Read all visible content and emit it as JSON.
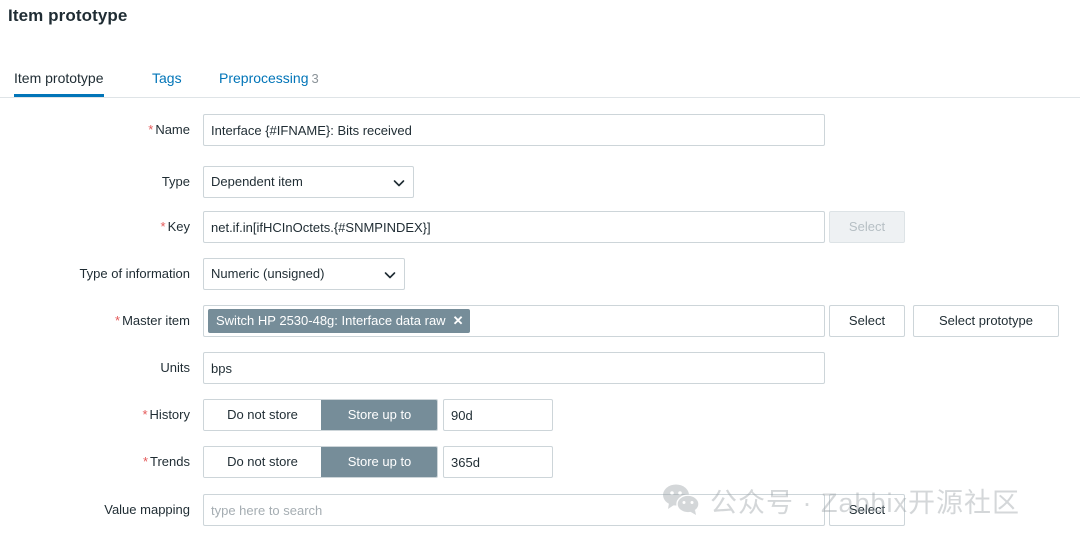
{
  "page": {
    "title": "Item prototype"
  },
  "tabs": [
    {
      "label": "Item prototype",
      "active": true
    },
    {
      "label": "Tags",
      "active": false
    },
    {
      "label": "Preprocessing",
      "count": "3",
      "active": false
    }
  ],
  "form": {
    "name": {
      "label": "Name",
      "required": true,
      "value": "Interface {#IFNAME}: Bits received"
    },
    "type": {
      "label": "Type",
      "required": false,
      "value": "Dependent item"
    },
    "key": {
      "label": "Key",
      "required": true,
      "value": "net.if.in[ifHCInOctets.{#SNMPINDEX}]",
      "button": "Select",
      "button_disabled": true
    },
    "type_of_information": {
      "label": "Type of information",
      "required": false,
      "value": "Numeric (unsigned)"
    },
    "master_item": {
      "label": "Master item",
      "required": true,
      "chip": "Switch HP 2530-48g: Interface data raw",
      "chip_remove": "✕",
      "button_select": "Select",
      "button_select_prototype": "Select prototype"
    },
    "units": {
      "label": "Units",
      "required": false,
      "value": "bps"
    },
    "history": {
      "label": "History",
      "required": true,
      "options": [
        "Do not store",
        "Store up to"
      ],
      "selected": "Store up to",
      "value": "90d"
    },
    "trends": {
      "label": "Trends",
      "required": true,
      "options": [
        "Do not store",
        "Store up to"
      ],
      "selected": "Store up to",
      "value": "365d"
    },
    "value_mapping": {
      "label": "Value mapping",
      "required": false,
      "placeholder": "type here to search",
      "value": "",
      "button": "Select"
    }
  },
  "watermark": {
    "text": "公众号 · Zabbix开源社区"
  },
  "colors": {
    "accent": "#0275b8",
    "required": "#e45959",
    "chip": "#768d99",
    "border": "#cdd5d9",
    "text": "#1f2c33"
  }
}
